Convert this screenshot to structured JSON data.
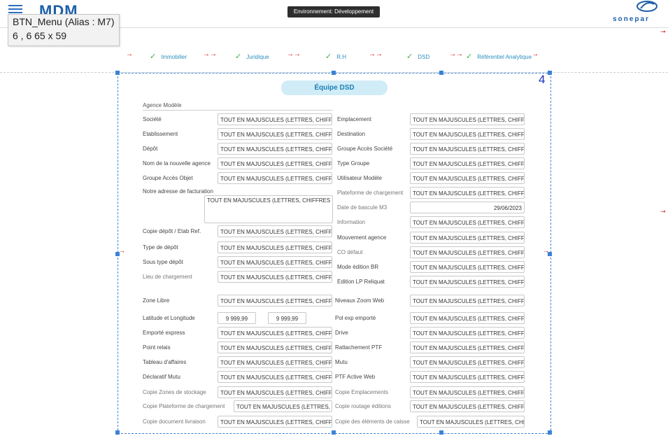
{
  "header": {
    "app_logo": "MDM",
    "environment": "Environnement: Développement",
    "brand": "sonepar",
    "menu_icon": "hamburger-icon"
  },
  "tooltip": {
    "line1": "BTN_Menu (Alias : M7)",
    "line2": "6 , 6     65 x 59"
  },
  "tabs": [
    {
      "label": "Immobilier"
    },
    {
      "label": "Juridique"
    },
    {
      "label": "R.H"
    },
    {
      "label": "DSD"
    },
    {
      "label": "Référentiel Analytique"
    }
  ],
  "form": {
    "title": "Équipe DSD",
    "corner_number": "4",
    "section": "Agence Modèle",
    "placeholder": "TOUT EN MAJUSCULES (LETTRES, CHIFFRES ET",
    "date_value": "29/06/2023",
    "lat_value": "9 999,99",
    "long_value": "9 999,99",
    "left_labels": [
      "Société",
      "Etablissement",
      "Dépôt",
      "Nom de la nouvelle agence",
      "Groupe Accès Objet",
      "Notre adresse de facturation",
      "Copie dépôt / Etab Ref.",
      "Type de dépôt",
      "Sous type dépôt",
      "Lieu de chargement",
      "Zone Libre",
      "Latitude et Longitude",
      "Emporté express",
      "Point relais",
      "Tableau d'affaires",
      "Déclaratif Mutu",
      "Copie Zones de stockage",
      "Copie Plateforme de chargement",
      "Copie document livraison"
    ],
    "right_labels": [
      "Emplacement",
      "Destination",
      "Groupe Accès Société",
      "Type Groupe",
      "Utilisateur Modèle",
      "Plateforme de chargement",
      "Date de bascule M3",
      "Information",
      "Mouvement agence",
      "CO défaut",
      "Mode édition BR",
      "Edition LP Reliquat",
      "Niveaux Zoom Web",
      "Pol exp emporté",
      "Drive",
      "Rattachement PTF",
      "Mutu",
      "PTF Active Web",
      "Copie Emplacements",
      "Copie routage éditions",
      "Copie des éléments de caisse"
    ]
  }
}
